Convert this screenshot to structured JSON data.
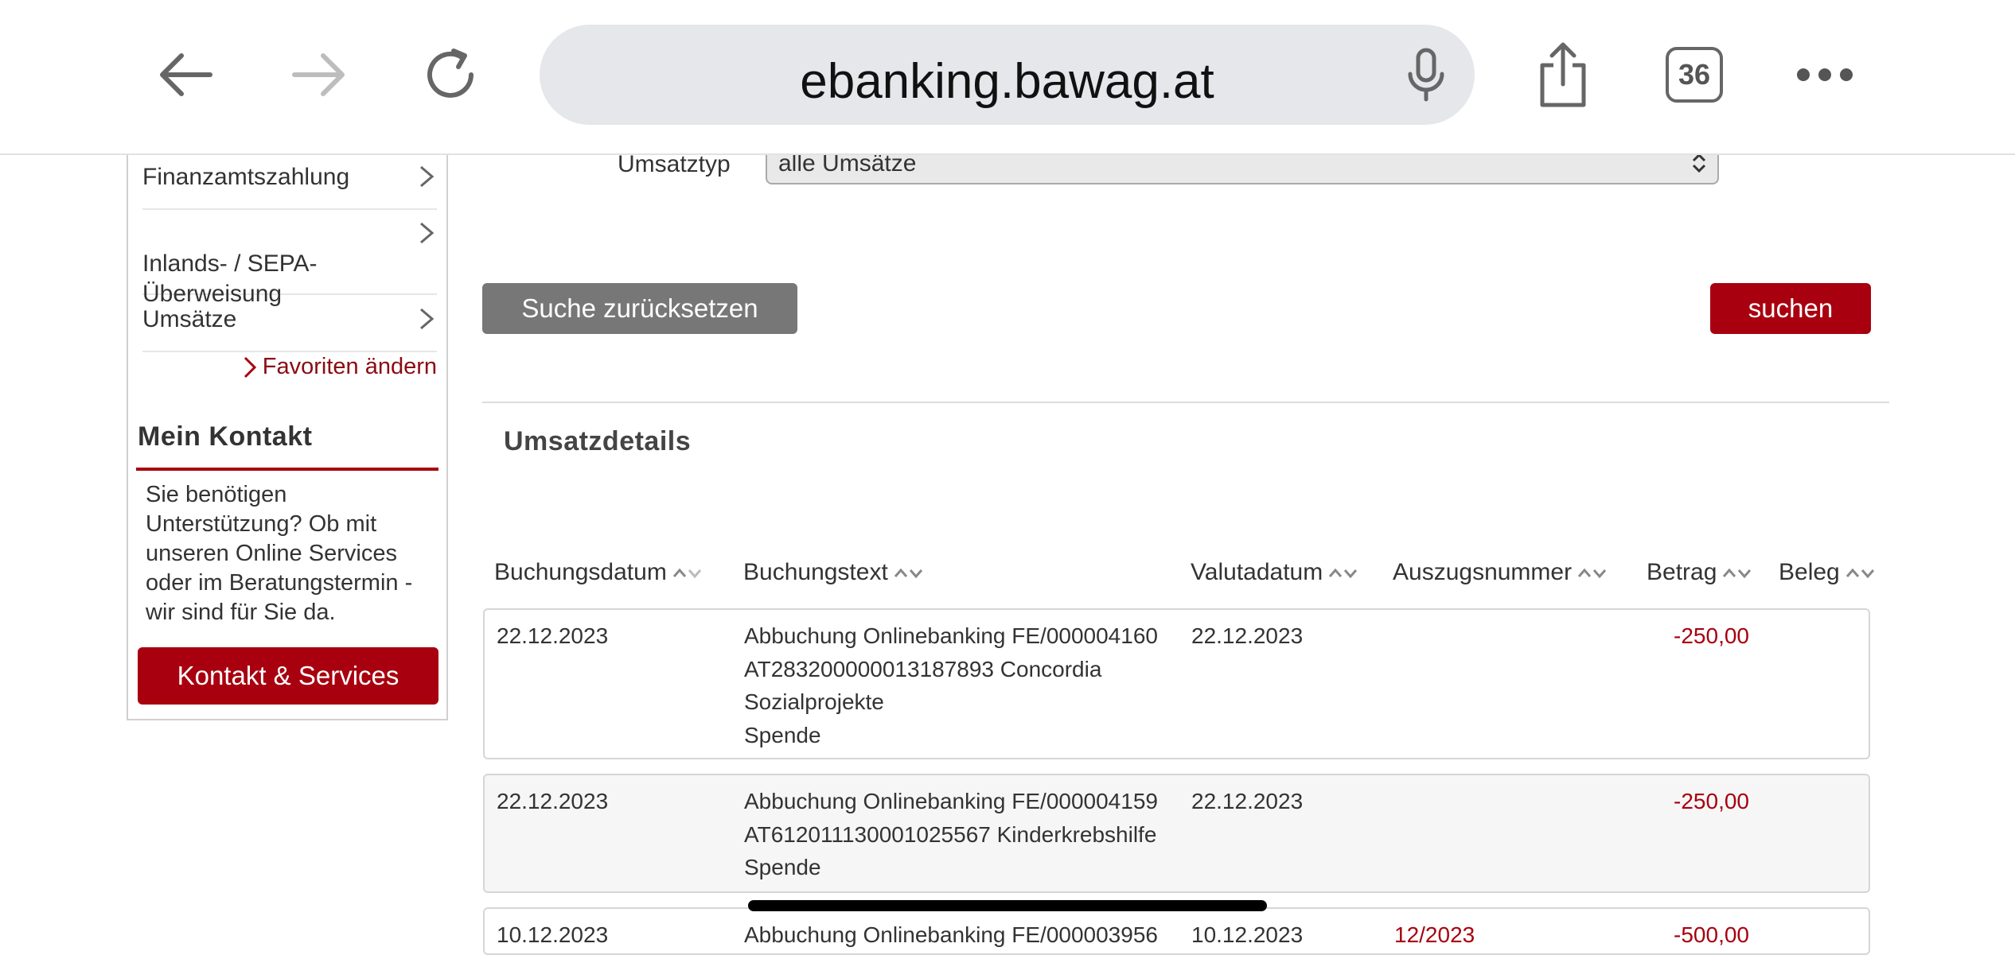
{
  "browser": {
    "url": "ebanking.bawag.at",
    "tab_count": "36",
    "icons": [
      "back-arrow-icon",
      "forward-arrow-icon",
      "reload-icon",
      "microphone-icon",
      "share-icon",
      "tabs-icon",
      "more-icon"
    ]
  },
  "sidebar": {
    "items": [
      {
        "label": "Finanzamtszahlung"
      },
      {
        "label": "Inlands- / SEPA-\nÜberweisung"
      },
      {
        "label": "Umsätze"
      }
    ],
    "favorites_link": "Favoriten ändern",
    "contact": {
      "title": "Mein Kontakt",
      "text": "Sie benötigen Unterstützung? Ob mit unseren Online Services oder im Beratungstermin - wir sind für Sie da.",
      "button": "Kontakt & Services"
    }
  },
  "filters": {
    "type_label": "Umsatztyp",
    "type_value": "alle Umsätze",
    "reset_button": "Suche zurücksetzen",
    "search_button": "suchen"
  },
  "details": {
    "title": "Umsatzdetails",
    "columns": [
      "Buchungsdatum",
      "Buchungstext",
      "Valutadatum",
      "Auszugsnummer",
      "Betrag",
      "Beleg"
    ],
    "rows": [
      {
        "booking_date": "22.12.2023",
        "text": [
          "Abbuchung Onlinebanking FE/000004160",
          "AT283200000013187893 Concordia",
          "Sozialprojekte",
          "Spende"
        ],
        "value_date": "22.12.2023",
        "statement": "",
        "amount": "-250,00",
        "receipt": ""
      },
      {
        "booking_date": "22.12.2023",
        "text": [
          "Abbuchung Onlinebanking FE/000004159",
          "AT612011130001025567 Kinderkrebshilfe",
          "Spende"
        ],
        "value_date": "22.12.2023",
        "statement": "",
        "amount": "-250,00",
        "receipt": ""
      },
      {
        "booking_date": "10.12.2023",
        "text": [
          "Abbuchung Onlinebanking FE/000003956"
        ],
        "value_date": "10.12.2023",
        "statement": "12/2023",
        "amount": "-500,00",
        "receipt": ""
      }
    ]
  },
  "colors": {
    "brand_red": "#a8000f",
    "link_red": "#8b0b13",
    "grey_button": "#777777"
  }
}
